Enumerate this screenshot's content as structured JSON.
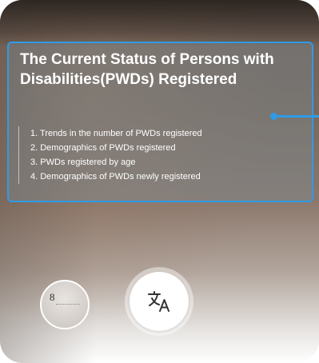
{
  "document": {
    "title": "The Current Status of Persons with Disabilities(PWDs) Registered",
    "items": [
      "1. Trends in the number of PWDs registered",
      "2. Demographics of PWDs registered",
      "3. PWDs registered by age",
      "4. Demographics of PWDs newly registered"
    ]
  },
  "gallery_thumbnail": {
    "visible_text": "8"
  },
  "controls": {
    "translate_icon": "translate-icon"
  },
  "colors": {
    "accent": "#2f9be6",
    "text": "#ffffff"
  }
}
